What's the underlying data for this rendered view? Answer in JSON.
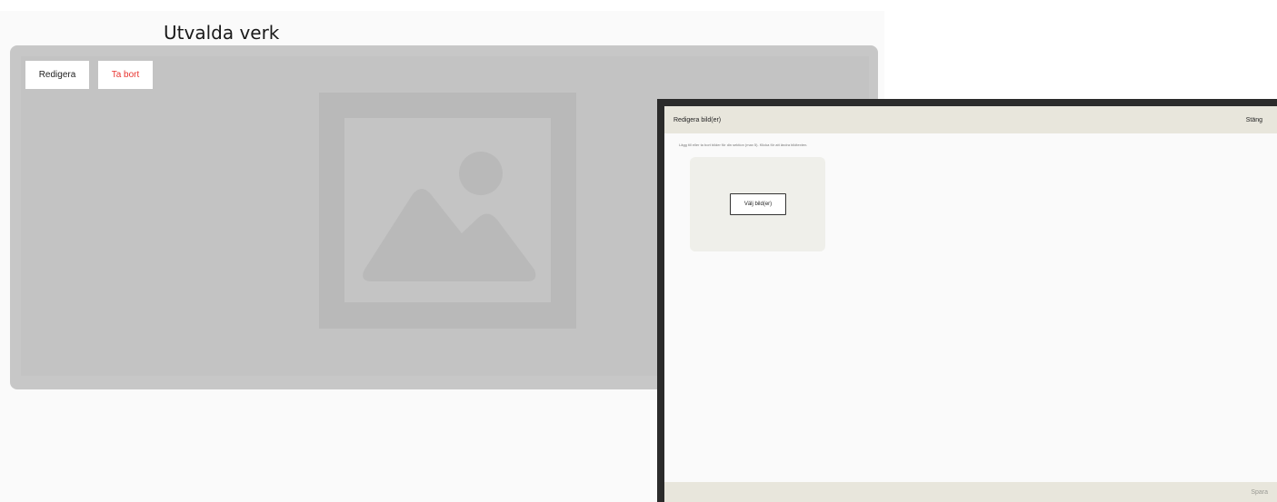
{
  "page": {
    "section_title": "Utvalda verk"
  },
  "gallery": {
    "edit_label": "Redigera",
    "remove_label": "Ta bort",
    "remove_color": "#e8342f",
    "placeholder_icon": "image-placeholder-icon"
  },
  "modal": {
    "title": "Redigera bild(er)",
    "close_label": "Stäng",
    "help_text": "Lägg till eller ta bort bilder för din sektion (max 5). Klicka för att ändra bildtexten.",
    "choose_label": "Välj bild(er)",
    "save_label": "Spara",
    "header_color": "#e8e6dc"
  }
}
